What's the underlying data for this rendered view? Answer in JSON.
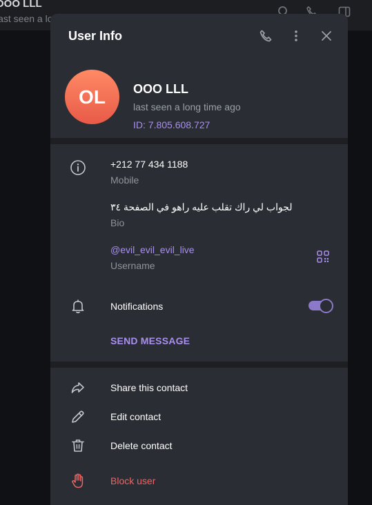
{
  "background_chat": {
    "title": "OOO LLL",
    "subtitle": "last seen a lo"
  },
  "modal": {
    "title": "User Info",
    "header_icons": [
      "phone-icon",
      "more-vertical-icon",
      "close-icon"
    ]
  },
  "profile": {
    "initials": "OL",
    "name": "OOO LLL",
    "status": "last seen a long time ago",
    "id_text": "ID: 7.805.608.727",
    "avatar_colors": [
      "#ff8a65",
      "#e85a48"
    ]
  },
  "info": {
    "phone": "+212 77 434 1188",
    "phone_label": "Mobile",
    "bio": "لجواب لي راك تقلب عليه راهو في الصفحة ٣٤",
    "bio_label": "Bio",
    "username": "@evil_evil_evil_live",
    "username_label": "Username",
    "notifications_label": "Notifications",
    "notifications_enabled": true,
    "send_message": "SEND MESSAGE"
  },
  "actions": [
    {
      "label": "Share this contact",
      "icon": "share-icon"
    },
    {
      "label": "Edit contact",
      "icon": "pencil-icon"
    },
    {
      "label": "Delete contact",
      "icon": "trash-icon"
    },
    {
      "label": "Block user",
      "icon": "hand-stop-icon",
      "danger": true
    }
  ],
  "colors": {
    "accent": "#a98ff0",
    "danger": "#ef6464",
    "panel": "#2a2d33"
  }
}
